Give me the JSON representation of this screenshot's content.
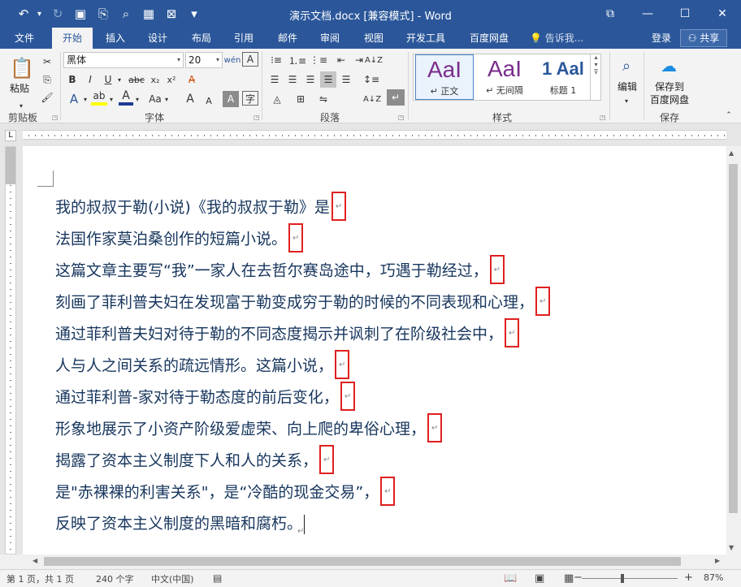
{
  "window": {
    "title": "演示文档.docx [兼容模式] - Word",
    "accent": "#2b579a"
  },
  "qat": {
    "undo_icon": "undo-icon",
    "redo_icon": "redo-icon",
    "save_icon": "save-icon"
  },
  "tabs": [
    {
      "label": "文件"
    },
    {
      "label": "开始"
    },
    {
      "label": "插入"
    },
    {
      "label": "设计"
    },
    {
      "label": "布局"
    },
    {
      "label": "引用"
    },
    {
      "label": "邮件"
    },
    {
      "label": "审阅"
    },
    {
      "label": "视图"
    },
    {
      "label": "开发工具"
    },
    {
      "label": "百度网盘"
    }
  ],
  "tellme": "告诉我...",
  "login": "登录",
  "share": "共享",
  "ribbon": {
    "paste_label": "粘贴",
    "clipboard_label": "剪贴板",
    "font_group_label": "字体",
    "paragraph_group_label": "段落",
    "styles_group_label": "样式",
    "save_group_label": "保存",
    "font_name": "黑体",
    "font_size": "20",
    "bold": "B",
    "italic": "I",
    "underline": "U",
    "strike": "abc",
    "subscript": "x₂",
    "superscript": "x²",
    "case": "Aa",
    "grow": "A",
    "shrink": "A",
    "char_border": "A",
    "styles": [
      {
        "sample": "AaI",
        "name": "↵ 正文"
      },
      {
        "sample": "AaI",
        "name": "↵ 无间隔"
      },
      {
        "sample": "1 Aal",
        "name": "标题 1"
      }
    ],
    "edit_label": "编辑",
    "save_baidu_line1": "保存到",
    "save_baidu_line2": "百度网盘"
  },
  "document": {
    "lines": [
      "我的叔叔于勒(小说)《我的叔叔于勒》是",
      "法国作家莫泊桑创作的短篇小说。",
      "这篇文章主要写“我”一家人在去哲尔赛岛途中，巧遇于勒经过，",
      "刻画了菲利普夫妇在发现富于勒变成穷于勒的时候的不同表现和心理，",
      "通过菲利普夫妇对待于勒的不同态度揭示并讽刺了在阶级社会中，",
      "人与人之间关系的疏远情形。这篇小说，",
      "通过菲利普-家对待于勒态度的前后变化，",
      "形象地展示了小资产阶级爱虚荣、向上爬的卑俗心理，",
      "揭露了资本主义制度下人和人的关系，",
      "是\"赤裸裸的利害关系\"，是“冷酷的现金交易”，",
      "反映了资本主义制度的黑暗和腐朽。"
    ],
    "text_color": "#17365d",
    "highlight_color": "#e02020"
  },
  "status": {
    "page": "第 1 页，共 1 页",
    "words": "240 个字",
    "language": "中文(中国)",
    "zoom": "87%",
    "zoom_level": 87
  }
}
